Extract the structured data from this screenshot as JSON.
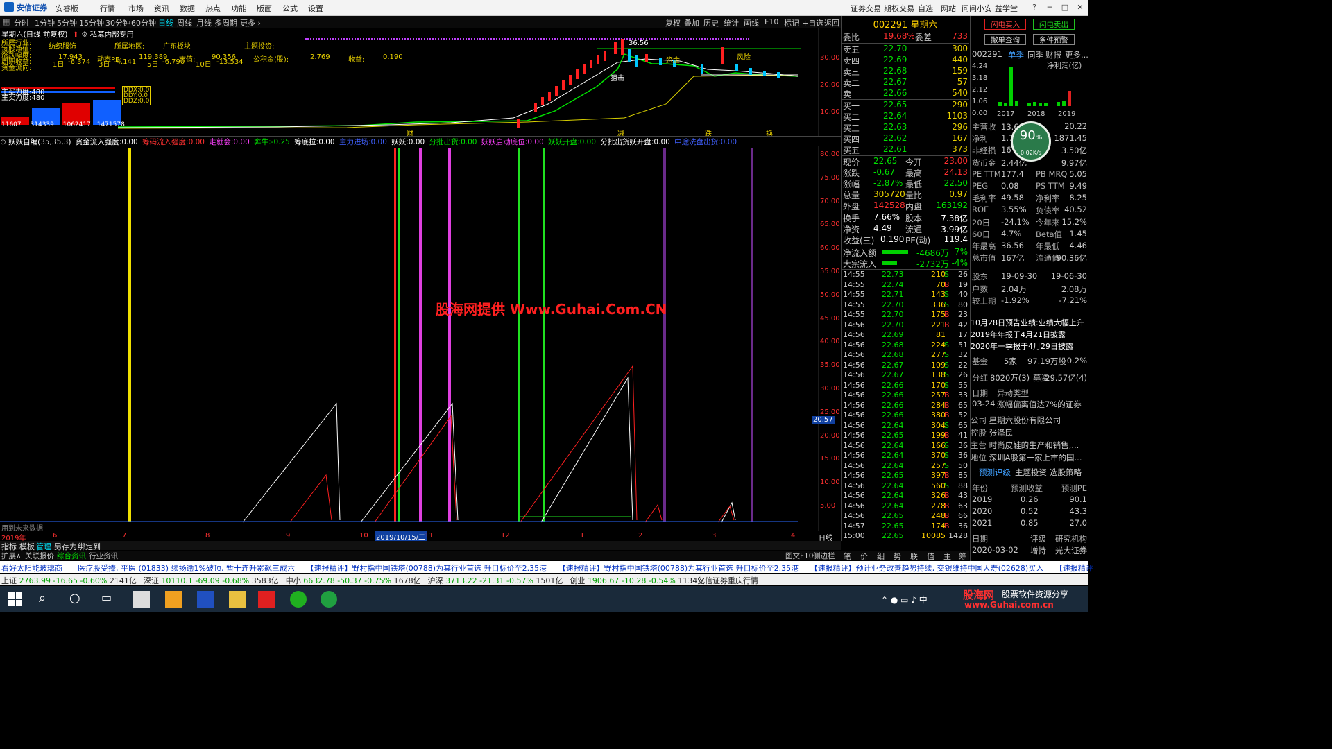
{
  "menu": {
    "brand": "安信证券",
    "brand_sub": "安睿版",
    "items": [
      "行情",
      "市场",
      "资讯",
      "数据",
      "热点",
      "功能",
      "版面",
      "公式",
      "设置"
    ],
    "right_items": [
      "证券交易",
      "期权交易",
      "自选",
      "网站",
      "问问小安",
      "益学堂"
    ]
  },
  "periods": [
    "分时",
    "1分钟",
    "5分钟",
    "15分钟",
    "30分钟",
    "60分钟",
    "日线",
    "周线",
    "月线",
    "多周期",
    "更多 ›"
  ],
  "active_period": "日线",
  "toolbar": [
    "复权",
    "叠加",
    "历史",
    "统计",
    "画线",
    "F10",
    "标记",
    "+自选",
    "返回"
  ],
  "stock": {
    "title": "星期六(日线 前复权)",
    "tag": "私募内部专用",
    "code": "002291",
    "name": "星期六"
  },
  "info": {
    "l1": [
      [
        "所属行业:",
        "纺织服饰"
      ],
      [
        "所属地区:",
        "广东板块"
      ],
      [
        "主题投资:",
        ""
      ]
    ],
    "l2": [
      [
        "17.943"
      ],
      [
        "动态PE:",
        "119.389"
      ],
      [
        "市值:",
        "90.356"
      ],
      [
        "公积金(股):",
        "2.769"
      ],
      [
        "收益:",
        "0.190"
      ]
    ],
    "l3": [
      [
        "1日",
        "-6.374"
      ],
      [
        "3日",
        "-4.141"
      ],
      [
        "5日",
        "-6.790"
      ],
      [
        "10日",
        "-13.534"
      ]
    ],
    "left_labels": [
      "所属行业:",
      "每股净值:",
      "涨跌幅度:",
      "周期收益:",
      "资金流向:"
    ],
    "funds": [
      "主买力度:480",
      "主卖力度:480"
    ],
    "ddx": [
      "DDX:0.0",
      "DDY:0.0",
      "DDZ:0.0"
    ],
    "bars_nums": [
      "11607",
      "314339",
      "1062417",
      "1471578"
    ]
  },
  "kline_labels": {
    "high_label": "36.56",
    "marks": [
      "狙击",
      "吸筹",
      "加",
      "减",
      "风险",
      "资金",
      "加",
      "风险"
    ],
    "bottom_marks": [
      "财",
      "减",
      "跌",
      "换"
    ],
    "axis": [
      "30.00",
      "20.00",
      "10.00"
    ]
  },
  "indicator": {
    "name": "妖妖自编(35,35,3)",
    "items": [
      [
        "资金流入强度:",
        "0.00",
        "#ffffff"
      ],
      [
        "筹码流入强度:",
        "0.00",
        "#ff3030"
      ],
      [
        "走就会:",
        "0.00",
        "#ff40ff"
      ],
      [
        "奔牛:",
        "-0.25",
        "#00e000"
      ],
      [
        "筹底拉:",
        "0.00",
        "#ffffff"
      ],
      [
        "主力进场:",
        "0.00",
        "#4060ff"
      ],
      [
        "妖妖:",
        "0.00",
        "#ffffff"
      ],
      [
        "分批出货:",
        "0.00",
        "#00e000"
      ],
      [
        "妖妖启动底位:",
        "0.00",
        "#ff40ff"
      ],
      [
        "妖妖开盘:",
        "0.00",
        "#00e000"
      ],
      [
        "分批出货妖开盘:",
        "0.00",
        "#ffffff"
      ],
      [
        "中途洗盘出货:",
        "0.00",
        "#4060ff"
      ]
    ],
    "axis": [
      "80.00",
      "75.00",
      "70.00",
      "65.00",
      "60.00",
      "55.00",
      "50.00",
      "45.00",
      "40.00",
      "35.00",
      "30.00",
      "25.00",
      "20.00",
      "15.00",
      "10.00",
      "5.00"
    ],
    "marker": "20.57",
    "footer": "用到未来数据"
  },
  "time_axis": [
    "2019年",
    "6",
    "7",
    "8",
    "9",
    "10",
    "2019/10/15/二",
    "11",
    "12",
    "1",
    "2",
    "3",
    "4"
  ],
  "axis_right": "日线",
  "bottom_tabs": [
    "指标",
    "模板",
    "管理",
    "另存为",
    "绑定到"
  ],
  "bottom_tabs2": [
    "扩展∧",
    "关联报价",
    "综合资讯",
    "行业资讯"
  ],
  "f10": "图文F10",
  "f10b": "侧边栏",
  "watermark": "股海网提供 Www.Guhai.Com.CN",
  "quote": {
    "header": "002291 星期六",
    "weibi": [
      "委比",
      "19.68%",
      "委差",
      "733"
    ],
    "sell": [
      [
        "卖五",
        "22.70",
        "300"
      ],
      [
        "卖四",
        "22.69",
        "440"
      ],
      [
        "卖三",
        "22.68",
        "159"
      ],
      [
        "卖二",
        "22.67",
        "57"
      ],
      [
        "卖一",
        "22.66",
        "540"
      ]
    ],
    "buy": [
      [
        "买一",
        "22.65",
        "290"
      ],
      [
        "买二",
        "22.64",
        "1103"
      ],
      [
        "买三",
        "22.63",
        "296"
      ],
      [
        "买四",
        "22.62",
        "167"
      ],
      [
        "买五",
        "22.61",
        "373"
      ]
    ],
    "stats": [
      [
        "现价",
        "22.65",
        "今开",
        "23.00"
      ],
      [
        "涨跌",
        "-0.67",
        "最高",
        "24.13"
      ],
      [
        "涨幅",
        "-2.87%",
        "最低",
        "22.50"
      ],
      [
        "总量",
        "305720",
        "量比",
        "0.97"
      ],
      [
        "外盘",
        "142528",
        "内盘",
        "163192"
      ],
      [
        "换手",
        "7.66%",
        "股本",
        "7.38亿"
      ],
      [
        "净资",
        "4.49",
        "流通",
        "3.99亿"
      ],
      [
        "收益(三)",
        "0.190",
        "PE(动)",
        "119.4"
      ]
    ],
    "flows": [
      [
        "净流入额",
        "-4686万",
        "-7%"
      ],
      [
        "大宗流入",
        "-2732万",
        "-4%"
      ]
    ],
    "ticks": [
      [
        "14:55",
        "22.73",
        "210",
        "S",
        "26"
      ],
      [
        "14:55",
        "22.74",
        "70",
        "B",
        "19"
      ],
      [
        "14:55",
        "22.71",
        "143",
        "S",
        "40"
      ],
      [
        "14:55",
        "22.70",
        "336",
        "S",
        "80"
      ],
      [
        "14:55",
        "22.70",
        "175",
        "B",
        "23"
      ],
      [
        "14:56",
        "22.70",
        "221",
        "B",
        "42"
      ],
      [
        "14:56",
        "22.69",
        "81",
        "",
        "17"
      ],
      [
        "14:56",
        "22.68",
        "224",
        "S",
        "51"
      ],
      [
        "14:56",
        "22.68",
        "277",
        "S",
        "32"
      ],
      [
        "14:56",
        "22.67",
        "109",
        "S",
        "22"
      ],
      [
        "14:56",
        "22.67",
        "138",
        "S",
        "26"
      ],
      [
        "14:56",
        "22.66",
        "170",
        "S",
        "55"
      ],
      [
        "14:56",
        "22.66",
        "257",
        "B",
        "33"
      ],
      [
        "14:56",
        "22.66",
        "284",
        "B",
        "65"
      ],
      [
        "14:56",
        "22.66",
        "380",
        "B",
        "52"
      ],
      [
        "14:56",
        "22.64",
        "304",
        "S",
        "65"
      ],
      [
        "14:56",
        "22.65",
        "199",
        "B",
        "41"
      ],
      [
        "14:56",
        "22.64",
        "166",
        "S",
        "36"
      ],
      [
        "14:56",
        "22.64",
        "370",
        "S",
        "36"
      ],
      [
        "14:56",
        "22.64",
        "257",
        "S",
        "50"
      ],
      [
        "14:56",
        "22.65",
        "397",
        "B",
        "85"
      ],
      [
        "14:56",
        "22.64",
        "560",
        "S",
        "88"
      ],
      [
        "14:56",
        "22.64",
        "326",
        "B",
        "43"
      ],
      [
        "14:56",
        "22.64",
        "278",
        "B",
        "63"
      ],
      [
        "14:56",
        "22.65",
        "248",
        "B",
        "66"
      ],
      [
        "14:57",
        "22.65",
        "174",
        "B",
        "36"
      ],
      [
        "15:00",
        "22.65",
        "10085",
        "",
        "1428"
      ]
    ],
    "tabs": [
      "笔",
      "价",
      "细",
      "势",
      "联",
      "值",
      "主",
      "筹"
    ]
  },
  "fr": {
    "btn_buy": "闪电买入",
    "btn_sell": "闪电卖出",
    "btn_query": "撤单查询",
    "btn_alert": "条件预警",
    "code": "002291",
    "tabs": [
      "单季",
      "同季",
      "财报",
      "更多..."
    ],
    "chart_label": "净利润(亿)",
    "chart_y": [
      "4.24",
      "3.18",
      "2.12",
      "1.06",
      "0.00"
    ],
    "chart_x": [
      "2017",
      "2018",
      "2019"
    ],
    "fin": [
      [
        "主营收",
        "13.69亿",
        "",
        "20.22"
      ],
      [
        "净利",
        "1.7",
        "",
        "1871.45"
      ],
      [
        "非经损",
        "16",
        "",
        "3.50亿"
      ],
      [
        "货币金",
        "2.44亿",
        "",
        "9.97亿"
      ],
      [
        "PE TTM",
        "177.4",
        "PB MRQ",
        "5.05"
      ],
      [
        "PEG",
        "0.08",
        "PS TTM",
        "9.49"
      ],
      [
        "毛利率",
        "49.58",
        "净利率",
        "8.25"
      ],
      [
        "ROE",
        "3.55%",
        "负债率",
        "40.52"
      ],
      [
        "20日",
        "-24.1%",
        "今年来",
        "15.2%"
      ],
      [
        "60日",
        "4.7%",
        "Beta值",
        "1.45"
      ],
      [
        "年最高",
        "36.56",
        "年最低",
        "4.46"
      ],
      [
        "总市值",
        "167亿",
        "流通值",
        "90.36亿"
      ],
      [
        "股东",
        "19-09-30",
        "",
        "19-06-30"
      ],
      [
        "户数",
        "2.04万",
        "",
        "2.08万"
      ],
      [
        "较上期",
        "-1.92%",
        "",
        "-7.21%"
      ]
    ],
    "notes": [
      "10月28日预告业绩:业绩大幅上升",
      "2019年年报于4月21日披露",
      "2020年一季报于4月29日披露"
    ],
    "jijin": [
      "基金",
      "5家",
      "97.19万股",
      "0.2%"
    ],
    "fenhong": [
      "分红",
      "8020万(3)",
      "募资",
      "29.57亿(4)"
    ],
    "date_row": [
      "日期",
      "异动类型"
    ],
    "date_val": [
      "03-24",
      "涨幅偏离值达7%的证券"
    ],
    "company": [
      [
        "公司",
        "星期六股份有限公司"
      ],
      [
        "控股",
        "张泽民"
      ],
      [
        "主营",
        "时尚皮鞋的生产和销售,..."
      ],
      [
        "地位",
        "深圳A股第一家上市的国..."
      ]
    ],
    "pred_tabs": [
      "预测评级",
      "主题投资",
      "选股策略"
    ],
    "pred_head": [
      "年份",
      "预测收益",
      "预测PE"
    ],
    "pred": [
      [
        "2019",
        "0.26",
        "90.1"
      ],
      [
        "2020",
        "0.52",
        "43.3"
      ],
      [
        "2021",
        "0.85",
        "27.0"
      ]
    ],
    "pred2_head": [
      "日期",
      "评级",
      "研究机构"
    ],
    "pred2": [
      "2020-03-02",
      "增持",
      "光大证券"
    ],
    "gauge": "90",
    "gauge_sub": "0.02K/s"
  },
  "news": "看好太阳能玻璃商　　医疗股受捧, 平医 (01833) 续扬逾1%破顶, 暂十连升累飙三成六　　【速报精评】野村指中国铁塔(00788)为其行业首选 升目标价至2.35港　　【速报精评】野村指中国铁塔(00788)为其行业首选 升目标价至2.35港　　【速报精评】预计业务改善趋势持续, 交银维持中国人寿(02628)买入　　【速报精评",
  "indexes": [
    [
      "上证",
      "2763.99",
      "-16.65",
      "-0.60%",
      "2141亿"
    ],
    [
      "深证",
      "10110.1",
      "-69.09",
      "-0.68%",
      "3583亿"
    ],
    [
      "中小",
      "6632.78",
      "-50.37",
      "-0.75%",
      "1678亿"
    ],
    [
      "沪深",
      "3713.22",
      "-21.31",
      "-0.57%",
      "1501亿"
    ],
    [
      "创业",
      "1906.67",
      "-10.28",
      "-0.54%",
      "1134亿"
    ]
  ],
  "broker_status": "安信证券重庆行情",
  "taskbar_brand": "股海网",
  "taskbar_slogan": "股票软件资源分享",
  "taskbar_url": "www.Guhai.com.cn"
}
